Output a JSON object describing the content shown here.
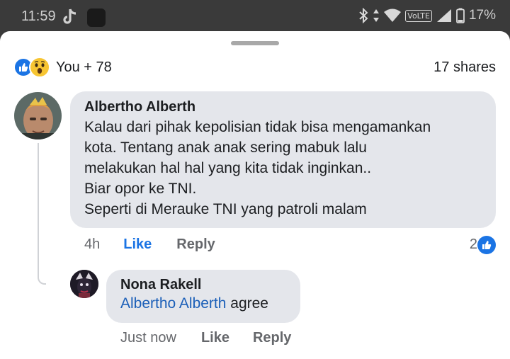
{
  "status_bar": {
    "time": "11:59",
    "volte": "VoLTE",
    "battery": "17%",
    "icons": [
      "tiktok-icon",
      "app-icon",
      "bluetooth-icon",
      "data-arrows-icon",
      "wifi-icon",
      "signal-icon",
      "battery-icon"
    ]
  },
  "reactions": {
    "icons": [
      "like-icon",
      "wow-icon"
    ],
    "summary": "You + 78"
  },
  "shares": "17 shares",
  "comment": {
    "author": "Albertho Alberth",
    "lines": [
      "Kalau dari pihak kepolisian tidak bisa mengamankan",
      "kota. Tentang anak anak sering mabuk lalu",
      "melakukan hal hal yang kita tidak inginkan..",
      "Biar opor ke TNI.",
      "Seperti di Merauke TNI yang patroli malam"
    ],
    "time": "4h",
    "like_label": "Like",
    "reply_label": "Reply",
    "reaction_count": "2"
  },
  "reply": {
    "author": "Nona Rakell",
    "mention": "Albertho Alberth",
    "text": "agree",
    "time": "Just now",
    "like_label": "Like",
    "reply_label": "Reply"
  },
  "colors": {
    "accent": "#1b74e4",
    "bubble": "#e4e6eb",
    "muted_text": "#65676b"
  }
}
